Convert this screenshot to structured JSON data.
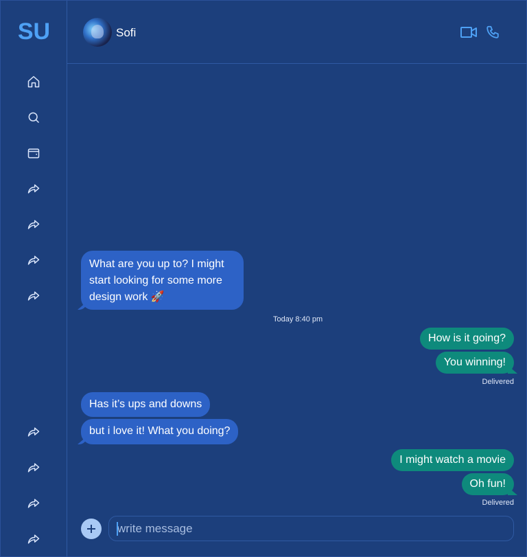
{
  "sidebar": {
    "logo": "SU",
    "top_icons": [
      "home-icon",
      "search-icon",
      "wallet-icon",
      "share-arrow-icon",
      "share-arrow-icon",
      "share-arrow-icon",
      "share-arrow-icon"
    ],
    "bottom_icons": [
      "share-arrow-icon",
      "share-arrow-icon",
      "share-arrow-icon",
      "share-arrow-icon"
    ]
  },
  "header": {
    "contact_name": "Sofi",
    "actions": [
      "video-call-icon",
      "phone-icon"
    ]
  },
  "conversation": {
    "messages": [
      {
        "direction": "incoming",
        "text_lines": [
          "What are you up to? I might",
          "start looking for some more",
          "design work 🚀"
        ]
      },
      {
        "direction": "outgoing",
        "text": "How is it going?"
      },
      {
        "direction": "outgoing",
        "text": "You winning!"
      },
      {
        "direction": "incoming",
        "text": "Has it’s ups and downs"
      },
      {
        "direction": "incoming",
        "text": "but i love it! What you doing?"
      },
      {
        "direction": "outgoing",
        "text": "I might watch a movie"
      },
      {
        "direction": "outgoing",
        "text": "Oh fun!"
      }
    ],
    "timestamp": "Today 8:40 pm",
    "status_1": "Delivered",
    "status_2": "Delivered"
  },
  "composer": {
    "placeholder": "write message",
    "value": ""
  },
  "colors": {
    "background": "#1c3f7c",
    "incoming_bubble": "#2d62c6",
    "outgoing_bubble": "#0e8a7c",
    "accent": "#4ea1f5"
  }
}
